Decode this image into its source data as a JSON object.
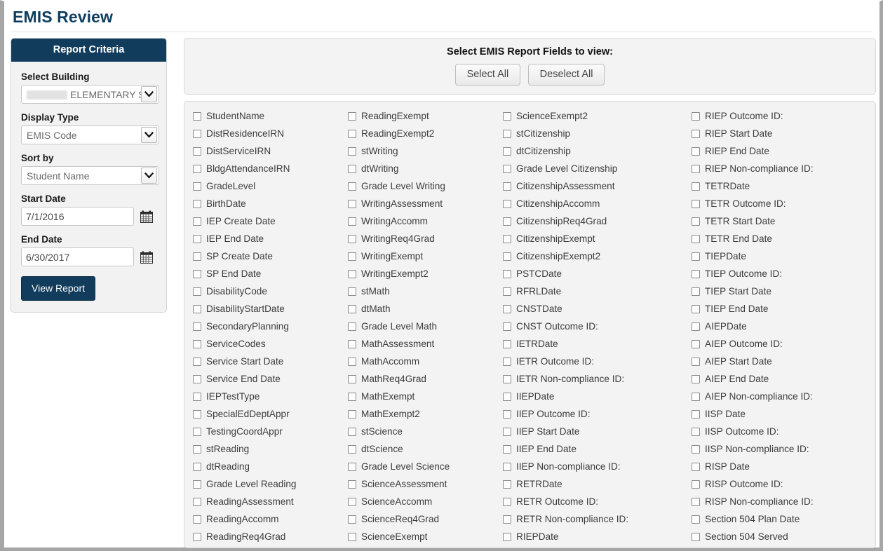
{
  "header": {
    "title": "EMIS Review"
  },
  "sidebar": {
    "panel_title": "Report Criteria",
    "building": {
      "label": "Select Building",
      "value": "ELEMENTARY S",
      "redacted": true
    },
    "display_type": {
      "label": "Display Type",
      "value": "EMIS Code"
    },
    "sort_by": {
      "label": "Sort by",
      "value": "Student Name"
    },
    "start_date": {
      "label": "Start Date",
      "value": "7/1/2016",
      "icon": "calendar-icon"
    },
    "end_date": {
      "label": "End Date",
      "value": "6/30/2017",
      "icon": "calendar-icon"
    },
    "view_report_label": "View Report"
  },
  "select_panel": {
    "title": "Select EMIS Report Fields to view:",
    "select_all_label": "Select All",
    "deselect_all_label": "Deselect All"
  },
  "colors": {
    "brand_navy": "#123c5c",
    "title_navy": "#0e3f60",
    "panel_bg": "#f3f3f3",
    "frame_gray": "#a6a6a6"
  },
  "fields": {
    "columns": [
      {
        "items": [
          "StudentName",
          "DistResidenceIRN",
          "DistServiceIRN",
          "BldgAttendanceIRN",
          "GradeLevel",
          "BirthDate",
          "IEP Create Date",
          "IEP End Date",
          "SP Create Date",
          "SP End Date",
          "DisabilityCode",
          "DisabilityStartDate",
          "SecondaryPlanning",
          "ServiceCodes",
          "Service Start Date",
          "Service End Date",
          "IEPTestType",
          "SpecialEdDeptAppr",
          "TestingCoordAppr",
          "stReading",
          "dtReading",
          "Grade Level Reading",
          "ReadingAssessment",
          "ReadingAccomm",
          "ReadingReq4Grad"
        ]
      },
      {
        "items": [
          "ReadingExempt",
          "ReadingExempt2",
          "stWriting",
          "dtWriting",
          "Grade Level Writing",
          "WritingAssessment",
          "WritingAccomm",
          "WritingReq4Grad",
          "WritingExempt",
          "WritingExempt2",
          "stMath",
          "dtMath",
          "Grade Level Math",
          "MathAssessment",
          "MathAccomm",
          "MathReq4Grad",
          "MathExempt",
          "MathExempt2",
          "stScience",
          "dtScience",
          "Grade Level Science",
          "ScienceAssessment",
          "ScienceAccomm",
          "ScienceReq4Grad",
          "ScienceExempt"
        ]
      },
      {
        "items": [
          "ScienceExempt2",
          "stCitizenship",
          "dtCitizenship",
          "Grade Level Citizenship",
          "CitizenshipAssessment",
          "CitizenshipAccomm",
          "CitizenshipReq4Grad",
          "CitizenshipExempt",
          "CitizenshipExempt2",
          "PSTCDate",
          "RFRLDate",
          "CNSTDate",
          "CNST Outcome ID:",
          "IETRDate",
          "IETR Outcome ID:",
          "IETR Non-compliance ID:",
          "IIEPDate",
          "IIEP Outcome ID:",
          "IIEP Start Date",
          "IIEP End Date",
          "IIEP Non-compliance ID:",
          "RETRDate",
          "RETR Outcome ID:",
          "RETR Non-compliance ID:",
          "RIEPDate"
        ]
      },
      {
        "items": [
          "RIEP Outcome ID:",
          "RIEP Start Date",
          "RIEP End Date",
          "RIEP Non-compliance ID:",
          "TETRDate",
          "TETR Outcome ID:",
          "TETR Start Date",
          "TETR End Date",
          "TIEPDate",
          "TIEP Outcome ID:",
          "TIEP Start Date",
          "TIEP End Date",
          "AIEPDate",
          "AIEP Outcome ID:",
          "AIEP Start Date",
          "AIEP End Date",
          "AIEP Non-compliance ID:",
          "IISP Date",
          "IISP Outcome ID:",
          "IISP Non-compliance ID:",
          "RISP Date",
          "RISP Outcome ID:",
          "RISP Non-compliance ID:",
          "Section 504 Plan Date",
          "Section 504 Served"
        ]
      }
    ]
  }
}
